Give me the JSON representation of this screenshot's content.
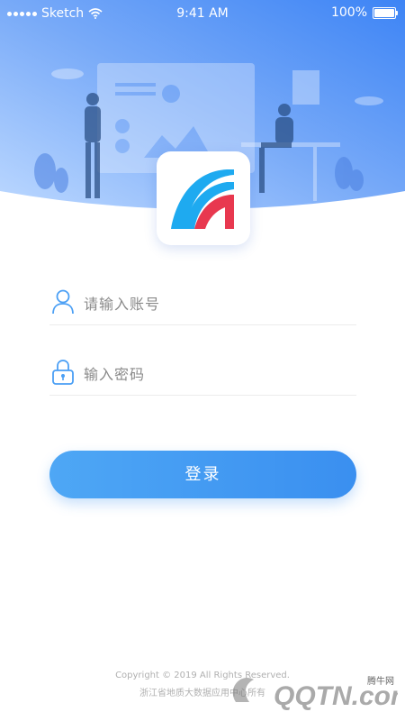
{
  "status_bar": {
    "carrier": "Sketch",
    "time": "9:41 AM",
    "battery": "100%"
  },
  "login": {
    "account_placeholder": "请输入账号",
    "password_placeholder": "输入密码",
    "submit_label": "登录"
  },
  "footer": {
    "copyright": "Copyright © 2019 All Rights Reserved.",
    "owner": "浙江省地质大数据应用中心所有"
  },
  "watermark": {
    "site": "腾牛网",
    "brand": "QQTN.com"
  },
  "colors": {
    "accent": "#3a8ff0",
    "header_gradient_start": "#bcd8ff",
    "header_gradient_end": "#3d84f5",
    "logo_blue": "#1eaaf0",
    "logo_red": "#e8384f"
  }
}
